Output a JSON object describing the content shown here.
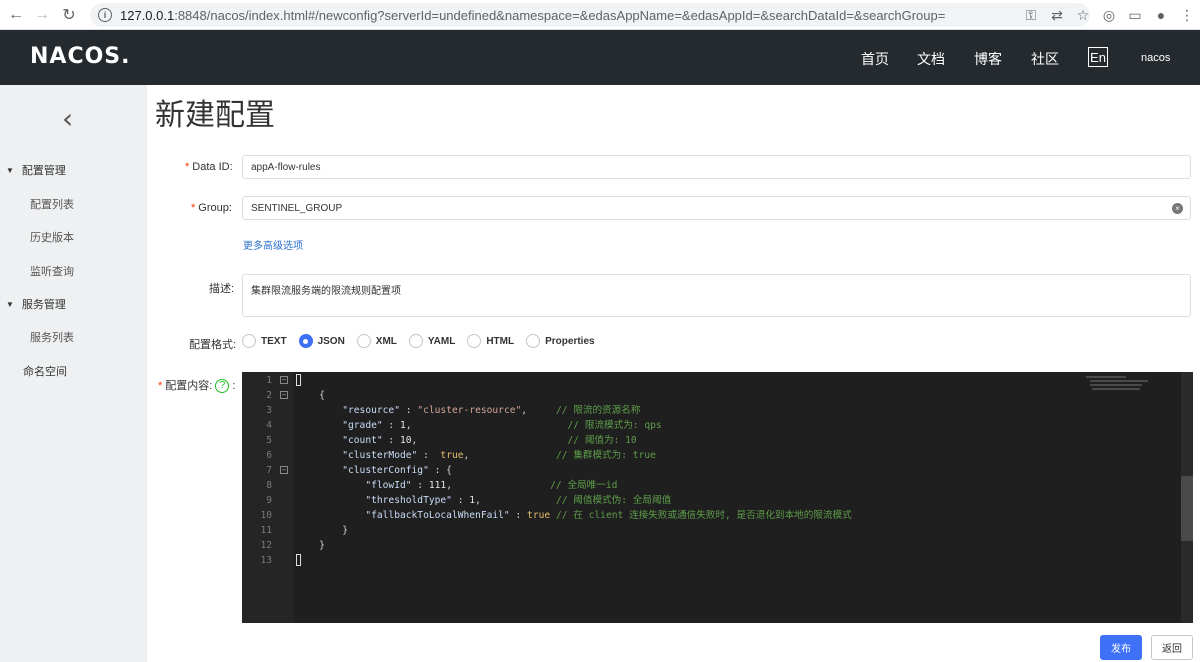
{
  "browser": {
    "url_host": "127.0.0.1",
    "url_rest": ":8848/nacos/index.html#/newconfig?serverId=undefined&namespace=&edasAppName=&edasAppId=&searchDataId=&searchGroup="
  },
  "header": {
    "logo": "NACOS.",
    "nav": [
      "首页",
      "文档",
      "博客",
      "社区"
    ],
    "lang": "En",
    "user": "nacos"
  },
  "sidebar": {
    "groups": [
      {
        "label": "配置管理",
        "items": [
          "配置列表",
          "历史版本",
          "监听查询"
        ]
      },
      {
        "label": "服务管理",
        "items": [
          "服务列表"
        ]
      }
    ],
    "single": "命名空间"
  },
  "page": {
    "title": "新建配置"
  },
  "form": {
    "data_id_label": "Data ID:",
    "data_id_value": "appA-flow-rules",
    "group_label": "Group:",
    "group_value": "SENTINEL_GROUP",
    "advanced_link": "更多高级选项",
    "desc_label": "描述:",
    "desc_value": "集群限流服务端的限流规则配置项",
    "format_label": "配置格式:",
    "formats": [
      "TEXT",
      "JSON",
      "XML",
      "YAML",
      "HTML",
      "Properties"
    ],
    "selected_format": "JSON",
    "content_label": "配置内容:",
    "help_icon": "?",
    "colon": ":"
  },
  "editor": {
    "lines": [
      {
        "n": "1",
        "fold": "⊟",
        "parts": [
          [
            "cursor",
            ""
          ]
        ]
      },
      {
        "n": "2",
        "fold": "⊟",
        "parts": [
          [
            "p",
            "    {"
          ]
        ]
      },
      {
        "n": "3",
        "fold": "",
        "parts": [
          [
            "p",
            "        "
          ],
          [
            "key",
            "\"resource\""
          ],
          [
            "p",
            " : "
          ],
          [
            "str",
            "\"cluster-resource\""
          ],
          [
            "p",
            ",     "
          ],
          [
            "cmt",
            "// 限流的资源名称"
          ]
        ]
      },
      {
        "n": "4",
        "fold": "",
        "parts": [
          [
            "p",
            "        "
          ],
          [
            "key",
            "\"grade\""
          ],
          [
            "p",
            " : "
          ],
          [
            "num",
            "1"
          ],
          [
            "p",
            ",                           "
          ],
          [
            "cmt",
            "// 限流模式为: qps"
          ]
        ]
      },
      {
        "n": "5",
        "fold": "",
        "parts": [
          [
            "p",
            "        "
          ],
          [
            "key",
            "\"count\""
          ],
          [
            "p",
            " : "
          ],
          [
            "num",
            "10"
          ],
          [
            "p",
            ",                          "
          ],
          [
            "cmt",
            "// 阈值为: 10"
          ]
        ]
      },
      {
        "n": "6",
        "fold": "",
        "parts": [
          [
            "p",
            "        "
          ],
          [
            "key",
            "\"clusterMode\""
          ],
          [
            "p",
            " :  "
          ],
          [
            "kw",
            "true"
          ],
          [
            "p",
            ",               "
          ],
          [
            "cmt",
            "// 集群模式为: true"
          ]
        ]
      },
      {
        "n": "7",
        "fold": "⊟",
        "parts": [
          [
            "p",
            "        "
          ],
          [
            "key",
            "\"clusterConfig\""
          ],
          [
            "p",
            " : {"
          ]
        ]
      },
      {
        "n": "8",
        "fold": "",
        "parts": [
          [
            "p",
            "            "
          ],
          [
            "key",
            "\"flowId\""
          ],
          [
            "p",
            " : "
          ],
          [
            "num",
            "111"
          ],
          [
            "p",
            ",                 "
          ],
          [
            "cmt",
            "// 全局唯一id"
          ]
        ]
      },
      {
        "n": "9",
        "fold": "",
        "parts": [
          [
            "p",
            "            "
          ],
          [
            "key",
            "\"thresholdType\""
          ],
          [
            "p",
            " : "
          ],
          [
            "num",
            "1"
          ],
          [
            "p",
            ",             "
          ],
          [
            "cmt",
            "// 阈值模式伪: 全局阈值"
          ]
        ]
      },
      {
        "n": "10",
        "fold": "",
        "parts": [
          [
            "p",
            "            "
          ],
          [
            "key",
            "\"fallbackToLocalWhenFail\""
          ],
          [
            "p",
            " : "
          ],
          [
            "kw",
            "true"
          ],
          [
            "p",
            " "
          ],
          [
            "cmt",
            "// 在 client 连接失败或通信失败时, 是否退化到本地的限流模式"
          ]
        ]
      },
      {
        "n": "11",
        "fold": "",
        "parts": [
          [
            "p",
            "        }"
          ]
        ]
      },
      {
        "n": "12",
        "fold": "",
        "parts": [
          [
            "p",
            "    }"
          ]
        ]
      },
      {
        "n": "13",
        "fold": "",
        "parts": [
          [
            "cursor",
            ""
          ]
        ]
      }
    ]
  },
  "actions": {
    "publish": "发布",
    "back": "返回"
  }
}
